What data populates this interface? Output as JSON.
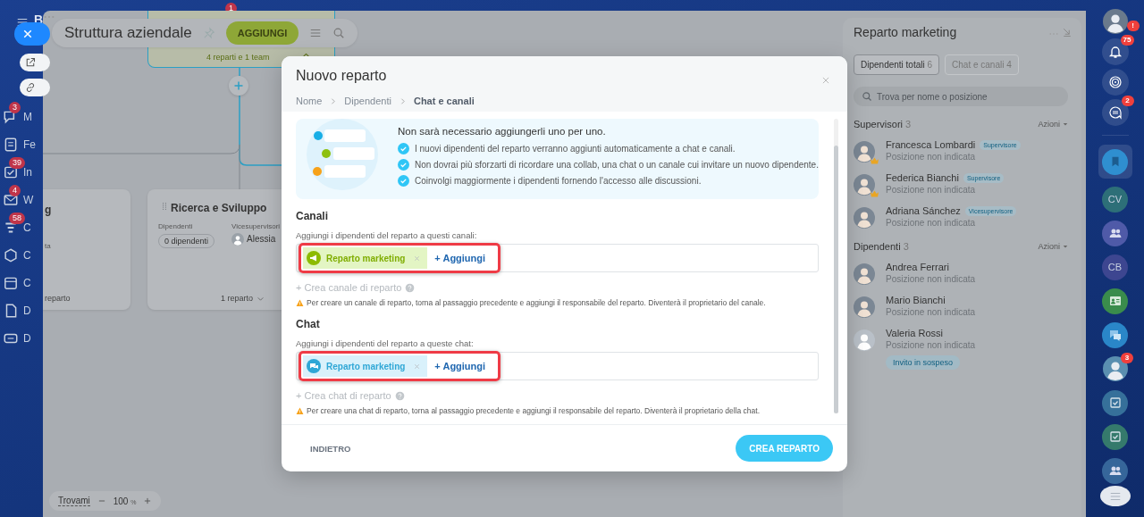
{
  "nav": {
    "brand": "B",
    "top_badge": "1",
    "items": [
      {
        "text": "M",
        "badge": "3"
      },
      {
        "text": "Fe"
      },
      {
        "text": "In",
        "badge": "39"
      },
      {
        "text": "W",
        "badge": "4"
      },
      {
        "text": "C",
        "badge": "58"
      },
      {
        "text": "C"
      },
      {
        "text": "C"
      },
      {
        "text": "D"
      },
      {
        "text": "D"
      }
    ]
  },
  "structure": {
    "title": "Struttura aziendale",
    "add_button": "AGGIUNGI",
    "root_summary": "4 reparti e 1 team",
    "cards": [
      {
        "title": "g",
        "note": "ta",
        "footer": "reparto"
      },
      {
        "title": "Ricerca e Sviluppo",
        "employees_label": "Dipendenti",
        "employees": "0 dipendenti",
        "deputies_label": "Vicesupervisori",
        "deputy": "Alessia",
        "footer": "1 reparto"
      }
    ],
    "find_button": "Trovami",
    "zoom": "100",
    "zoom_unit": "%"
  },
  "modal": {
    "title": "Nuovo reparto",
    "steps": [
      {
        "label": "Nome",
        "selected": false
      },
      {
        "label": "Dipendenti",
        "selected": false
      },
      {
        "label": "Chat e canali",
        "selected": true
      }
    ],
    "intro": {
      "text": "Non sarà necessario aggiungerli uno per uno.",
      "points": [
        "I nuovi dipendenti del reparto verranno aggiunti automaticamente a chat e canali.",
        "Non dovrai più sforzarti di ricordare una collab, una chat o un canale cui invitare un nuovo dipendente.",
        "Coinvolgi maggiormente i dipendenti fornendo l'accesso alle discussioni."
      ]
    },
    "sections": [
      {
        "kind": "channel",
        "title": "Canali",
        "hint": "Aggiungi i dipendenti del reparto a questi canali:",
        "tags": [
          "Reparto marketing"
        ],
        "add_label": "+ Aggiungi",
        "highlighted": true,
        "create_link": "+ Crea canale di reparto",
        "warning": "Per creare un canale di reparto, torna al passaggio precedente e aggiungi il responsabile del reparto. Diventerà il proprietario del canale."
      },
      {
        "kind": "chat",
        "title": "Chat",
        "hint": "Aggiungi i dipendenti del reparto a queste chat:",
        "tags": [
          "Reparto marketing"
        ],
        "add_label": "+ Aggiungi",
        "highlighted": true,
        "create_link": "+ Crea chat di reparto",
        "warning": "Per creare una chat di reparto, torna al passaggio precedente e aggiungi il responsabile del reparto. Diventerà il proprietario della chat."
      }
    ],
    "back_button": "INDIETRO",
    "submit_button": "CREA REPARTO"
  },
  "panel": {
    "title": "Reparto marketing",
    "tabs": [
      {
        "label": "Dipendenti totali",
        "count": "6",
        "selected": true
      },
      {
        "label": "Chat e canali",
        "count": "4",
        "selected": false
      }
    ],
    "search": {
      "placeholder": "Trova per nome o posizione"
    },
    "groups": [
      {
        "title": "Supervisori",
        "count": "3",
        "actions": "Azioni",
        "people": [
          {
            "name": "Francesca Lombardi",
            "role": "Supervisore",
            "position": "Posizione non indicata",
            "crown": true,
            "photo": true
          },
          {
            "name": "Federica Bianchi",
            "role": "Supervisore",
            "position": "Posizione non indicata",
            "crown": true,
            "photo": true
          },
          {
            "name": "Adriana Sánchez",
            "role": "Vicesupervisore",
            "position": "Posizione non indicata",
            "crown": false,
            "photo": true
          }
        ]
      },
      {
        "title": "Dipendenti",
        "count": "3",
        "actions": "Azioni",
        "people": [
          {
            "name": "Andrea Ferrari",
            "position": "Posizione non indicata",
            "crown": false,
            "photo": true
          },
          {
            "name": "Mario Bianchi",
            "position": "Posizione non indicata",
            "crown": false,
            "photo": true
          },
          {
            "name": "Valeria Rossi",
            "position": "Posizione non indicata",
            "crown": false,
            "photo": false,
            "status": "Invito in sospeso"
          }
        ]
      }
    ]
  },
  "rightbar": {
    "top": [
      {
        "kind": "avatar",
        "badge": "!"
      },
      {
        "kind": "bell",
        "badge": "75"
      },
      {
        "kind": "target"
      },
      {
        "kind": "chat-sync",
        "badge": "2"
      }
    ],
    "apps": [
      {
        "kind": "bookmark",
        "color": "#2f8fd0",
        "selected": true
      },
      {
        "kind": "text",
        "text": "CV",
        "color": "#2d6f78",
        "selected": false
      },
      {
        "kind": "people",
        "color": "#4f5aa8",
        "selected": false
      },
      {
        "kind": "text",
        "text": "CB",
        "color": "#3d4690",
        "selected": false
      },
      {
        "kind": "card",
        "color": "#3a8c4c",
        "selected": false
      },
      {
        "kind": "bubbles",
        "color": "#2a86c8",
        "selected": false
      },
      {
        "kind": "avatar",
        "badge": "3",
        "color": "#5a8fb0",
        "selected": false
      },
      {
        "kind": "check",
        "color": "#36709a",
        "selected": false
      },
      {
        "kind": "check",
        "color": "#357a6c",
        "selected": false
      },
      {
        "kind": "people",
        "color": "#36669a",
        "selected": false
      }
    ]
  }
}
